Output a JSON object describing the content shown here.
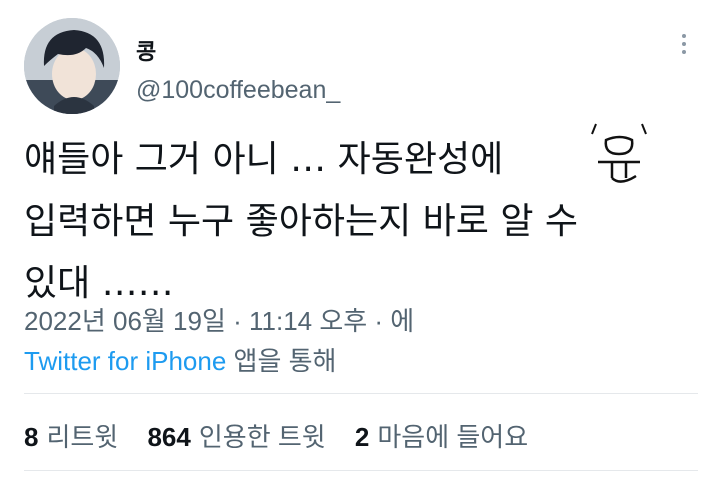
{
  "author": {
    "display_name": "콩",
    "handle": "@100coffeebean_"
  },
  "tweet": {
    "line1": "얘들아 그거 아니 … 자동완성에",
    "handwritten_char": "유",
    "line2": "입력하면 누구 좋아하는지 바로 알 수",
    "line3": "있대 ……"
  },
  "meta": {
    "timestamp": "2022년 06월 19일 · 11:14 오후 · 에",
    "source": "Twitter for iPhone",
    "source_suffix": "앱을 통해"
  },
  "stats": {
    "retweets_count": "8",
    "retweets_label": "리트윗",
    "quotes_count": "864",
    "quotes_label": "인용한 트윗",
    "likes_count": "2",
    "likes_label": "마음에 들어요"
  },
  "icons": [
    "more-options-icon"
  ],
  "colors": {
    "text": "#0f1419",
    "secondary": "#536471",
    "link": "#1d9bf0",
    "divider": "#e5e8eb"
  }
}
